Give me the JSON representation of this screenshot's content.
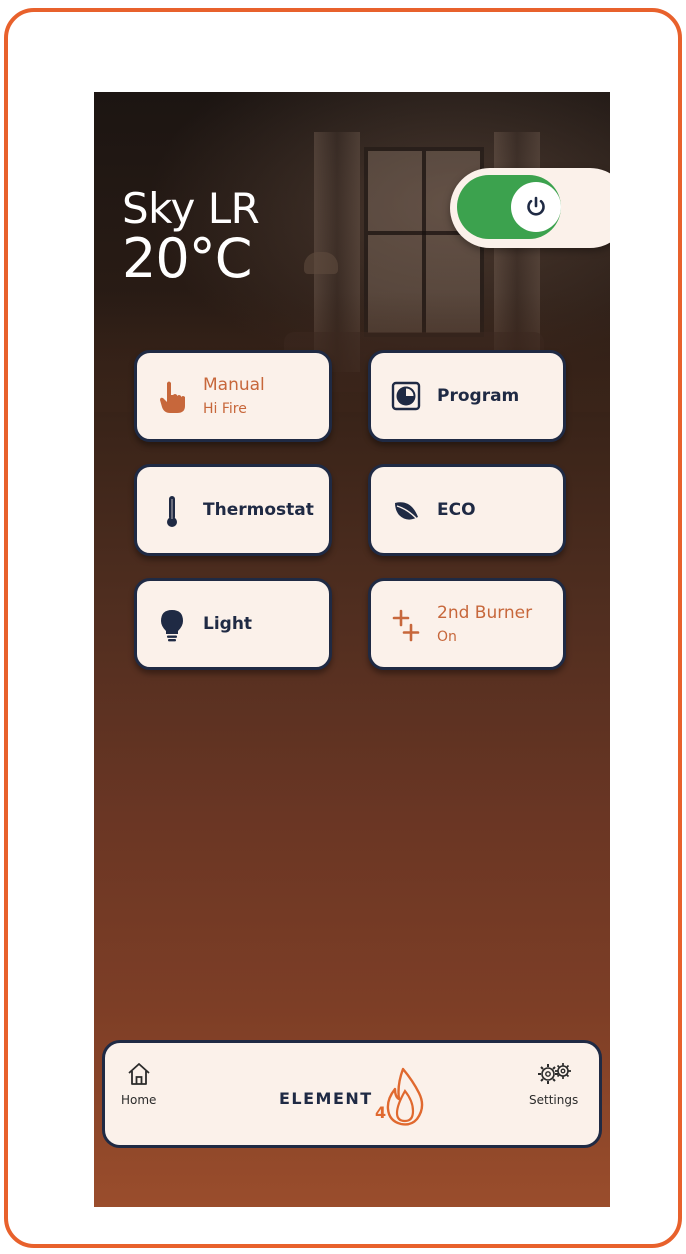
{
  "room": {
    "name": "Sky LR",
    "temperature": "20°C"
  },
  "power": {
    "state": "on",
    "icon": "power-icon",
    "track_color": "#3ca24e"
  },
  "modes": [
    {
      "id": "manual",
      "label": "Manual",
      "sub": "Hi Fire",
      "icon": "hand-pointer-icon"
    },
    {
      "id": "program",
      "label": "Program",
      "sub": "",
      "icon": "clock-icon"
    },
    {
      "id": "thermostat",
      "label": "Thermostat",
      "sub": "",
      "icon": "thermometer-icon"
    },
    {
      "id": "eco",
      "label": "ECO",
      "sub": "",
      "icon": "leaf-icon"
    },
    {
      "id": "light",
      "label": "Light",
      "sub": "",
      "icon": "lightbulb-icon"
    },
    {
      "id": "burner",
      "label": "2nd Burner",
      "sub": "On",
      "icon": "plus-plus-icon"
    }
  ],
  "nav": {
    "home_label": "Home",
    "settings_label": "Settings",
    "brand_word": "ELEMENT",
    "brand_number": "4"
  },
  "colors": {
    "accent": "#e0692f",
    "navy": "#1f2a44",
    "card": "#fbf1ea",
    "frame": "#e8612c"
  }
}
